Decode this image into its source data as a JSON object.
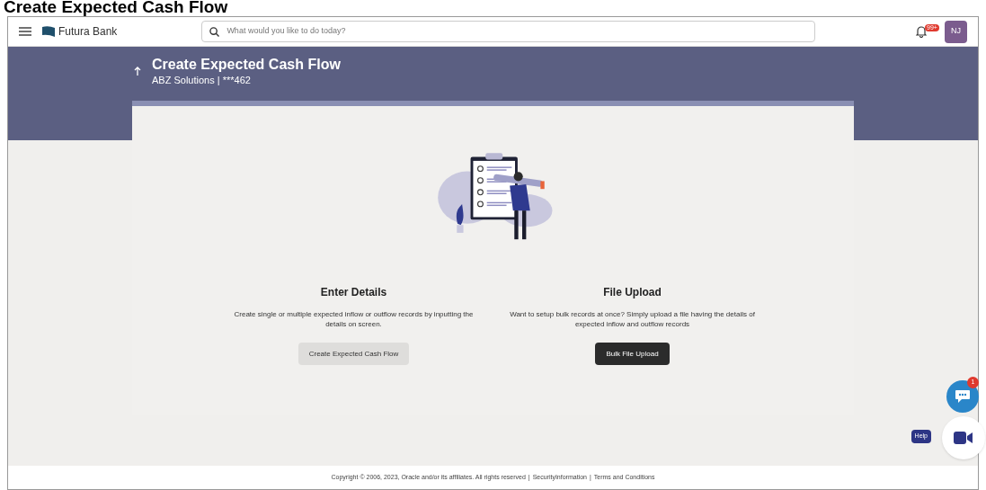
{
  "doc_title": "Create Expected Cash Flow",
  "header": {
    "brand": "Futura Bank",
    "search": {
      "placeholder": "What would you like to do today?"
    },
    "notification_badge": "99+",
    "avatar": "NJ"
  },
  "page": {
    "title": "Create Expected Cash Flow",
    "subtitle": "ABZ Solutions | ***462"
  },
  "options": [
    {
      "title": "Enter Details",
      "description": "Create single or multiple expected inflow or outflow records by inputting the details on screen.",
      "button": "Create Expected Cash Flow",
      "primary": false
    },
    {
      "title": "File Upload",
      "description": "Want to setup bulk records at once? Simply upload a file having the details of expected inflow and outflow records",
      "button": "Bulk File Upload",
      "primary": true
    }
  ],
  "chat_badge": "1",
  "help": "Help",
  "footer": {
    "copyright": "Copyright © 2006, 2023, Oracle and/or its affiliates. All rights reserved",
    "links": [
      "SecurityInformation",
      "Terms and Conditions"
    ],
    "separator": "|"
  }
}
